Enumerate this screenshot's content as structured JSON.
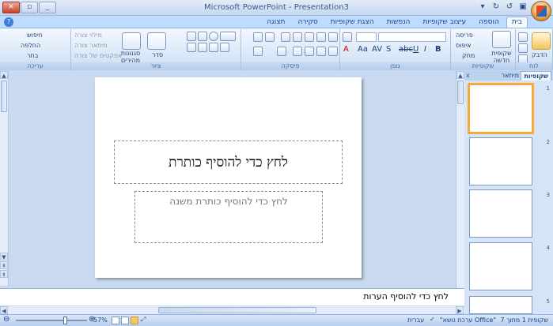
{
  "window": {
    "title": "Microsoft PowerPoint - Presentation3",
    "controls": {
      "close": "✕",
      "maximize": "▫",
      "minimize": "_"
    }
  },
  "tabs": [
    "בית",
    "הוספה",
    "עיצוב שקופיות",
    "הנפשות",
    "הצגת שקופיות",
    "סקירה",
    "תצוגה"
  ],
  "ribbon": {
    "groups": {
      "clipboard": "לוח",
      "slides": "שקופיות",
      "font": "גופן",
      "paragraph": "פיסקה",
      "drawing": "ציור",
      "editing": "עריכה"
    },
    "clipboard": {
      "paste": "הדבק"
    },
    "slides": {
      "new_slide": "שקופית חדשה",
      "layout": "פריסה",
      "reset": "איפוס",
      "delete": "מחק"
    },
    "drawing": {
      "arrange": "סדר",
      "quick_styles": "סגנונות מהירים",
      "fill": "מילוי צורה",
      "outline": "מיתאר צורה",
      "effects": "אפקטים של צורה"
    },
    "editing": {
      "find": "חיפוש",
      "replace": "החלפה",
      "select": "בחר"
    }
  },
  "panel": {
    "tab_slides": "שקופיות",
    "tab_outline": "מיתאר",
    "close": "x",
    "slide_numbers": [
      "1",
      "2",
      "3",
      "4",
      "5"
    ]
  },
  "slide": {
    "title_placeholder": "לחץ כדי להוסיף כותרת",
    "subtitle_placeholder": "לחץ כדי להוסיף כותרת משנה"
  },
  "notes": {
    "placeholder": "לחץ כדי להוסיף הערות"
  },
  "status": {
    "slide_count": "שקופית 1 מתוך 7",
    "theme": "\"ערכת נושא Office\"",
    "language": "עברית",
    "zoom": "57%"
  }
}
